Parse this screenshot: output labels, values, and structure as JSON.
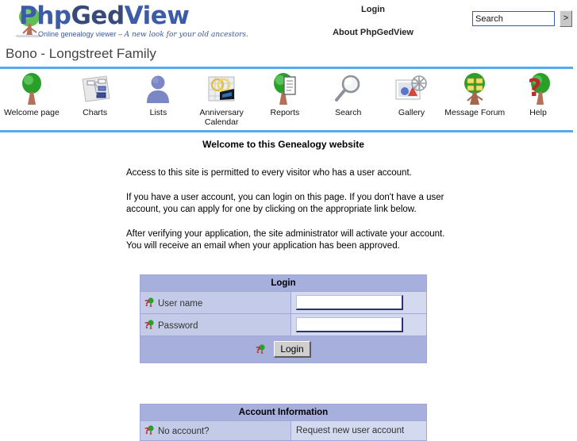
{
  "brand": {
    "wordmark_php": "Php",
    "wordmark_ged": "Ged",
    "wordmark_view": "View",
    "tagline_prefix": "Online genealogy viewer – ",
    "tagline_script": "A new look for your old ancestors.",
    "accent_blue": "#55abec",
    "logo_blue": "#3c5ca8",
    "table_header_bg": "#a7b0dc",
    "table_label_bg": "#c3cbe8",
    "table_value_bg": "#d3d9ee"
  },
  "header": {
    "login_link": "Login",
    "about_link": "About PhpGedView",
    "search_value": "Search",
    "search_placeholder": "Search",
    "search_go_label": ">"
  },
  "page_title": "Bono - Longstreet Family",
  "nav": {
    "items": [
      {
        "label": "Welcome page",
        "icon": "tree-icon"
      },
      {
        "label": "Charts",
        "icon": "charts-icon"
      },
      {
        "label": "Lists",
        "icon": "person-icon"
      },
      {
        "label": "Anniversary Calendar",
        "icon": "calendar-rings-icon"
      },
      {
        "label": "Reports",
        "icon": "tree-document-icon"
      },
      {
        "label": "Search",
        "icon": "magnifier-icon"
      },
      {
        "label": "Gallery",
        "icon": "gallery-icon"
      },
      {
        "label": "Message Forum",
        "icon": "tree-messages-icon"
      },
      {
        "label": "Help",
        "icon": "question-tree-icon"
      }
    ]
  },
  "main": {
    "welcome_heading": "Welcome to this Genealogy website",
    "paragraphs": [
      "Access to this site is permitted to every visitor who has a user account.",
      "If you have a user account, you can login on this page. If you don't have a user account, you can apply for one by clicking on the appropriate link below.",
      "After verifying your application, the site administrator will activate your account. You will receive an email when your application has been approved."
    ]
  },
  "login_form": {
    "title": "Login",
    "username_label": "User name",
    "username_value": "",
    "password_label": "Password",
    "password_value": "",
    "submit_label": "Login"
  },
  "account_info": {
    "title": "Account Information",
    "no_account_label": "No account?",
    "request_account_link": "Request new user account"
  }
}
